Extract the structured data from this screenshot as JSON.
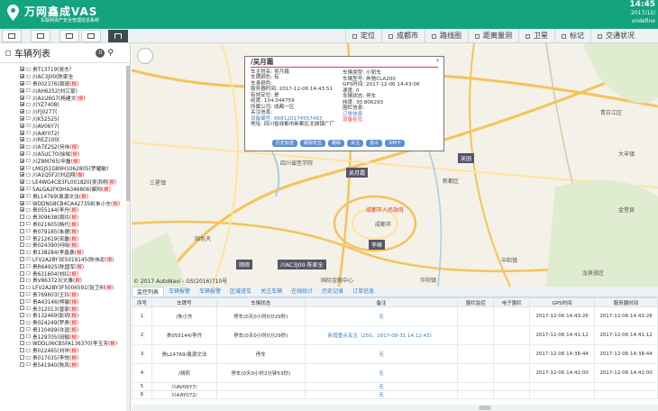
{
  "header": {
    "brand": "万网鑫成VAS",
    "brand_sub": "车联网资产安全管理信息系统",
    "time": "14:45",
    "date": "2017/12/",
    "user": "undefine"
  },
  "map_nav": [
    {
      "label": "定位",
      "icon": "checkbox-icon"
    },
    {
      "label": "成都市",
      "icon": "checkbox-icon"
    },
    {
      "label": "路线图",
      "icon": "checkbox-icon"
    },
    {
      "label": "距离量测",
      "icon": "checkbox-icon"
    },
    {
      "label": "卫星",
      "icon": "checkbox-icon"
    },
    {
      "label": "标记",
      "icon": "checkbox-icon"
    },
    {
      "label": "交通状况",
      "icon": "checkbox-icon"
    }
  ],
  "sidebar": {
    "title": "车辆列表",
    "vehicles": [
      {
        "name": "贵T13719(吴杰",
        "warn": ")",
        "checked": true
      },
      {
        "name": "川AC3J00(陈家全",
        "warn": "",
        "checked": true
      },
      {
        "name": "贵002376(周琦",
        "warn": "(报)",
        "checked": true
      },
      {
        "name": "川AH6252(刘江豪)",
        "warn": "",
        "checked": true
      },
      {
        "name": "川A1U6G7(杨建文",
        "warn": "(报)",
        "checked": true
      },
      {
        "name": "川YZ7408(",
        "warn": "",
        "checked": true
      },
      {
        "name": "川FJ0277(",
        "warn": "",
        "checked": true
      },
      {
        "name": "川K52525(",
        "warn": "",
        "checked": true
      },
      {
        "name": "川AV06Y7(",
        "warn": "",
        "checked": true
      },
      {
        "name": "川AAY072(",
        "warn": "",
        "checked": true
      },
      {
        "name": "川REZ100(",
        "warn": "",
        "checked": true
      },
      {
        "name": "川A7E2S2(何伟",
        "warn": "(报)",
        "checked": true
      },
      {
        "name": "川A5UC70(徐辉",
        "warn": "(报)",
        "checked": true
      },
      {
        "name": "川Z8M765(辛磊",
        "warn": "(报)",
        "checked": true
      },
      {
        "name": "LMGJS1G89H1062805(罗耀敏)",
        "warn": "",
        "checked": true
      },
      {
        "name": "川A1Q5F2(刘远翔",
        "warn": "(报)",
        "checked": true
      },
      {
        "name": "LE4WG4CB3FL001820(吴洪明",
        "warn": "(报)",
        "checked": true
      },
      {
        "name": "SALGA2FK9HA346806(蔡阳",
        "warn": "(报)",
        "checked": true
      },
      {
        "name": "贵L14769(袁源文法",
        "warn": "(报)",
        "checked": true
      },
      {
        "name": "WDDNG8CB4CA427358(朱小东",
        "warn": "(报)",
        "checked": true
      },
      {
        "name": "贵055144(李丹",
        "warn": "(报)",
        "checked": true
      },
      {
        "name": "贵309638(周玲",
        "warn": "(报)",
        "checked": false
      },
      {
        "name": "贵021605(杨代",
        "warn": "(报)",
        "checked": false
      },
      {
        "name": "贵079185(朱德",
        "warn": "(报)",
        "checked": false
      },
      {
        "name": "贵212619(宋磊",
        "warn": "(报)",
        "checked": false
      },
      {
        "name": "贵024390(何晓",
        "warn": "(报)",
        "checked": false
      },
      {
        "name": "贵138284(孝鑫桑",
        "warn": "(报)",
        "checked": false
      },
      {
        "name": "LFV2A2BY3E5019145(陈伟忠",
        "warn": "(报)",
        "checked": false
      },
      {
        "name": "贵R64925(陈国军",
        "warn": "(报)",
        "checked": false
      },
      {
        "name": "贵631604(刘红",
        "warn": "(报)",
        "checked": false
      },
      {
        "name": "贵V863723(文雅",
        "warn": "(报)",
        "checked": false
      },
      {
        "name": "LFV2A2BY3F5006591(张卫利",
        "warn": "(报)",
        "checked": false
      },
      {
        "name": "贵769603(王玲",
        "warn": "(报)",
        "checked": false
      },
      {
        "name": "贵A43146(熊敏",
        "warn": "(报)",
        "checked": false
      },
      {
        "name": "贵312013(曾家",
        "warn": "(报)",
        "checked": false
      },
      {
        "name": "贵132469(彭玥",
        "warn": "(报)",
        "checked": false
      },
      {
        "name": "贵024249(罗贵",
        "warn": "(报)",
        "checked": false
      },
      {
        "name": "贵110499(许逗",
        "warn": "(报)",
        "checked": false
      },
      {
        "name": "贵129705(田楷",
        "warn": "(报)",
        "checked": false
      },
      {
        "name": "WDDL06CB5FA136370(李玉芳",
        "warn": "(报)",
        "checked": false
      },
      {
        "name": "贵022465(刘学",
        "warn": "(报)",
        "checked": false
      },
      {
        "name": "贵017035(李悦",
        "warn": "(报)",
        "checked": false
      },
      {
        "name": "贵541940(陈凤",
        "warn": "(报)",
        "checked": false
      }
    ]
  },
  "map": {
    "labels": [
      "四川省医学院",
      "吴月霜",
      "吴园",
      "新都区",
      "成都市",
      "成都市人民政府",
      "李峰",
      "顺顺",
      "川AC3J00-陈家全",
      "国色天",
      "金堂县",
      "龙泉驿区",
      "青白江区",
      "中和镇",
      "三星镇",
      "大丰镇",
      "国际金融中心",
      "华阳镇"
    ],
    "copyright": "© 2017 AutoNavi - GS(2016)710号"
  },
  "popup": {
    "title": "/吴月霜",
    "left": [
      "车主姓名: 吴月霜",
      "车牌颜色: 有",
      "车身颜色:",
      "服务器时间: 2017-12-06 14:43:51",
      "有效定位: 是",
      "经度: 104.044759",
      "所属公司: 成都一区",
      "关注信息:",
      "设备编号: 868120174557493",
      "地址: 四川省成都市新都区北城镇广厂"
    ],
    "right": [
      "车辆类型: 小轿车",
      "车辆型号: 奔驰CLA200",
      "GPS时间: 2017-12-06 14:43:06",
      "速度: 0",
      "车辆状态: 停车",
      "纬度: 30.806293",
      "围栏信息:",
      "订单信息",
      "设备在位",
      ""
    ],
    "buttons": [
      "历史轨迹",
      "跟踪定位",
      "跟踪",
      "关注",
      "指令",
      "SIM卡"
    ],
    "close": "×"
  },
  "bottom": {
    "tabs": [
      "监控列表",
      "车辆报警",
      "车辆报警",
      "区域进车",
      "关注车辆",
      "在线统计",
      "历史记录",
      "订单信息"
    ],
    "columns": [
      "序号",
      "车牌号",
      "车辆状态",
      "备注",
      "围栏监控",
      "电子围栏",
      "GPS时间",
      "服务器时间"
    ],
    "rows": [
      {
        "no": "1",
        "plate": "/朱小东",
        "status": "停车(0天0小时0分29秒)",
        "remark": "无",
        "fence": "",
        "efence": "",
        "gps": "2017-12-06 14:43:26",
        "server": "2017-12-06 14:43:26"
      },
      {
        "no": "2",
        "plate": "贵055144/李丹",
        "status": "停车(0天0小时0分29秒)",
        "remark": "新增重点关注（250，2017-08-31 14:12:43）",
        "fence": "",
        "efence": "",
        "gps": "2017-12-06 14:41:12",
        "server": "2017-12-06 14:41:12"
      },
      {
        "no": "3",
        "plate": "贵L14769/袁源文法",
        "status": "停车",
        "remark": "无",
        "fence": "",
        "efence": "",
        "gps": "2017-12-06 14:38:44",
        "server": "2017-12-06 14:38:44"
      },
      {
        "no": "4",
        "plate": "/胡莉",
        "status": "停车(0天0小时2分钟53秒)",
        "remark": "无",
        "fence": "",
        "efence": "",
        "gps": "2017-12-06 14:42:00",
        "server": "2017-12-06 14:42:00"
      },
      {
        "no": "5",
        "plate": "川AV06Y7/",
        "status": "",
        "remark": "无",
        "fence": "",
        "efence": "",
        "gps": "",
        "server": ""
      },
      {
        "no": "6",
        "plate": "川AAY072/",
        "status": "",
        "remark": "无",
        "fence": "",
        "efence": "",
        "gps": "",
        "server": ""
      }
    ]
  }
}
